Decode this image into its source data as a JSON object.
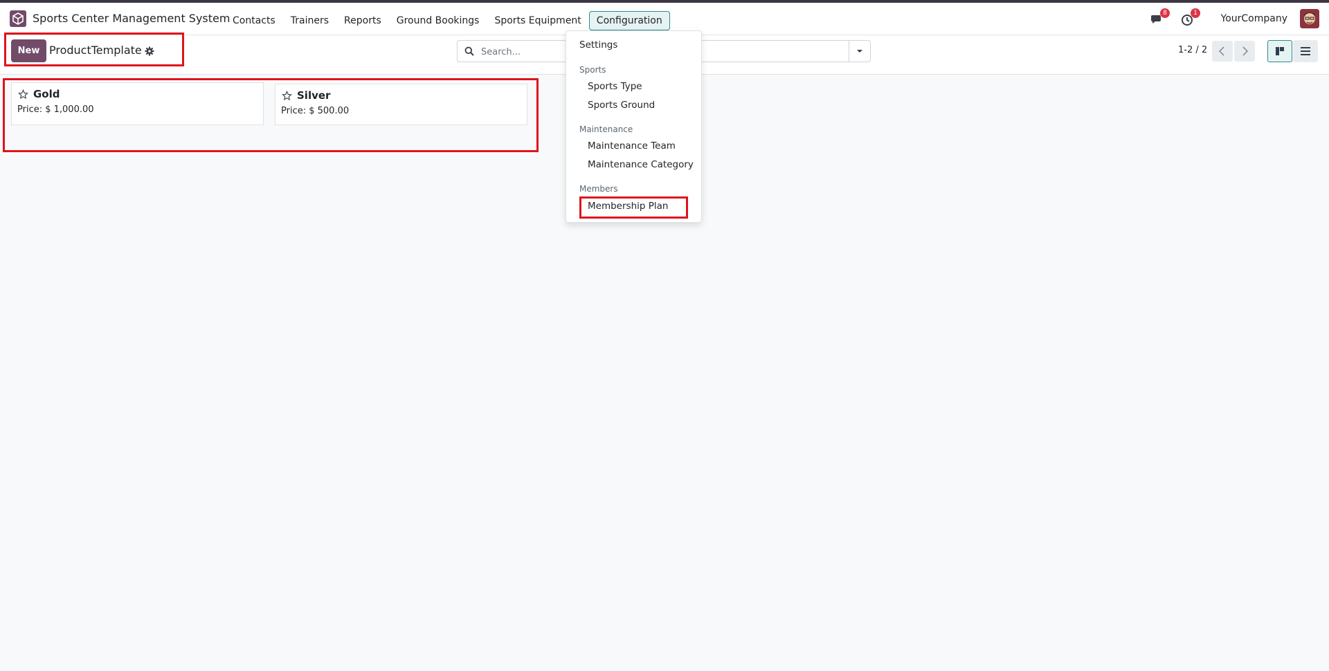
{
  "navbar": {
    "app_name": "Sports Center Management System",
    "menu": [
      {
        "label": "Contacts"
      },
      {
        "label": "Trainers"
      },
      {
        "label": "Reports"
      },
      {
        "label": "Ground Bookings"
      },
      {
        "label": "Sports Equipment"
      },
      {
        "label": "Configuration"
      }
    ],
    "messages_count": "8",
    "activities_count": "1",
    "company": "YourCompany"
  },
  "control": {
    "new_label": "New",
    "breadcrumb": "ProductTemplate",
    "search_placeholder": "Search...",
    "pager": "1-2 / 2"
  },
  "cards": [
    {
      "title": "Gold",
      "price": "Price: $ 1,000.00"
    },
    {
      "title": "Silver",
      "price": "Price: $ 500.00"
    }
  ],
  "dropdown": {
    "settings": "Settings",
    "sections": [
      {
        "header": "Sports",
        "items": [
          "Sports Type",
          "Sports Ground"
        ]
      },
      {
        "header": "Maintenance",
        "items": [
          "Maintenance Team",
          "Maintenance Category"
        ]
      },
      {
        "header": "Members",
        "items": [
          "Membership Plan"
        ]
      }
    ]
  },
  "colors": {
    "brand": "#714b67",
    "highlight": "#e0131b",
    "active_menu": "#2b8a8a"
  }
}
